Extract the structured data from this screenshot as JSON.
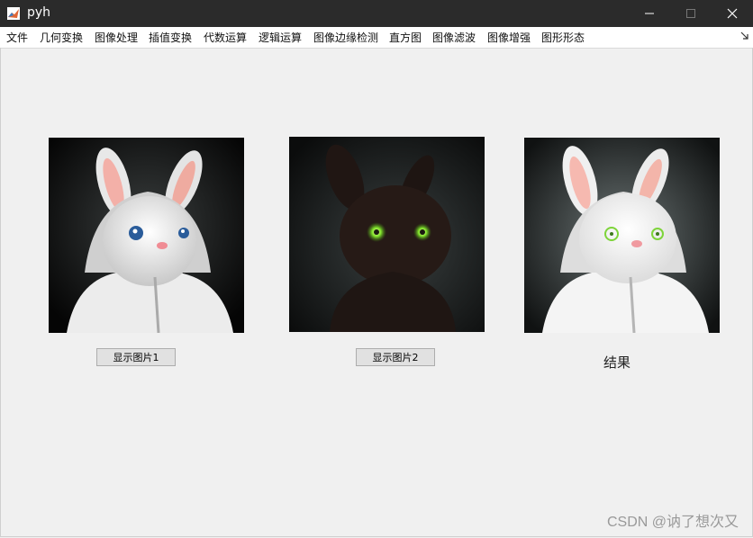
{
  "window": {
    "title": "pyh"
  },
  "menu": [
    "文件",
    "几何变换",
    "图像处理",
    "插值变换",
    "代数运算",
    "逻辑运算",
    "图像边缘检测",
    "直方图",
    "图像滤波",
    "图像增强",
    "图形形态"
  ],
  "images": [
    {
      "subject": "white-bunny-in-hoodie"
    },
    {
      "subject": "dark-bunny-glowing-eyes"
    },
    {
      "subject": "blended-result-bunny"
    }
  ],
  "buttons": {
    "show_image1": "显示图片1",
    "show_image2": "显示图片2"
  },
  "result_label": "结果",
  "watermark": "CSDN @讷了想次又",
  "colors": {
    "titlebar": "#2b2b2b",
    "background": "#f0f0f0",
    "button": "#e1e1e1"
  }
}
